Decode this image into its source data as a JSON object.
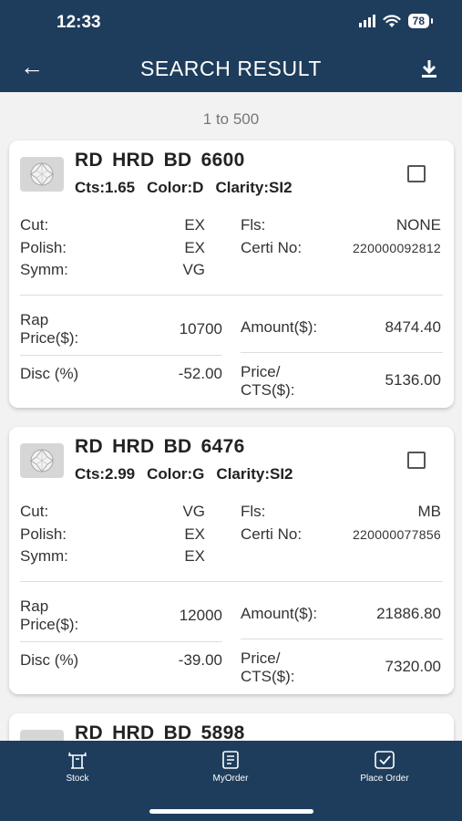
{
  "status": {
    "time": "12:33",
    "battery": "78"
  },
  "header": {
    "title": "SEARCH RESULT"
  },
  "range_text": "1 to 500",
  "labels": {
    "cut": "Cut:",
    "polish": "Polish:",
    "symm": "Symm:",
    "fls": "Fls:",
    "certi": "Certi No:",
    "rap1": "Rap",
    "rap2": "Price($):",
    "amount": "Amount($):",
    "disc": "Disc (%)",
    "ppc1": "Price/",
    "ppc2": "CTS($):"
  },
  "items": [
    {
      "title": "RD HRD BD 6600",
      "cts": "Cts:1.65",
      "color": "Color:D",
      "clarity": "Clarity:SI2",
      "cut": "EX",
      "polish": "EX",
      "symm": "VG",
      "fls": "NONE",
      "certi": "220000092812",
      "rap": "10700",
      "amount": "8474.40",
      "disc": "-52.00",
      "price_cts": "5136.00"
    },
    {
      "title": "RD HRD BD 6476",
      "cts": "Cts:2.99",
      "color": "Color:G",
      "clarity": "Clarity:SI2",
      "cut": "VG",
      "polish": "EX",
      "symm": "EX",
      "fls": "MB",
      "certi": "220000077856",
      "rap": "12000",
      "amount": "21886.80",
      "disc": "-39.00",
      "price_cts": "7320.00"
    },
    {
      "title": "RD HRD BD 5898"
    }
  ],
  "tabs": [
    {
      "label": "Stock",
      "icon": "stock-icon"
    },
    {
      "label": "MyOrder",
      "icon": "myorder-icon"
    },
    {
      "label": "Place Order",
      "icon": "place-order-icon"
    }
  ]
}
